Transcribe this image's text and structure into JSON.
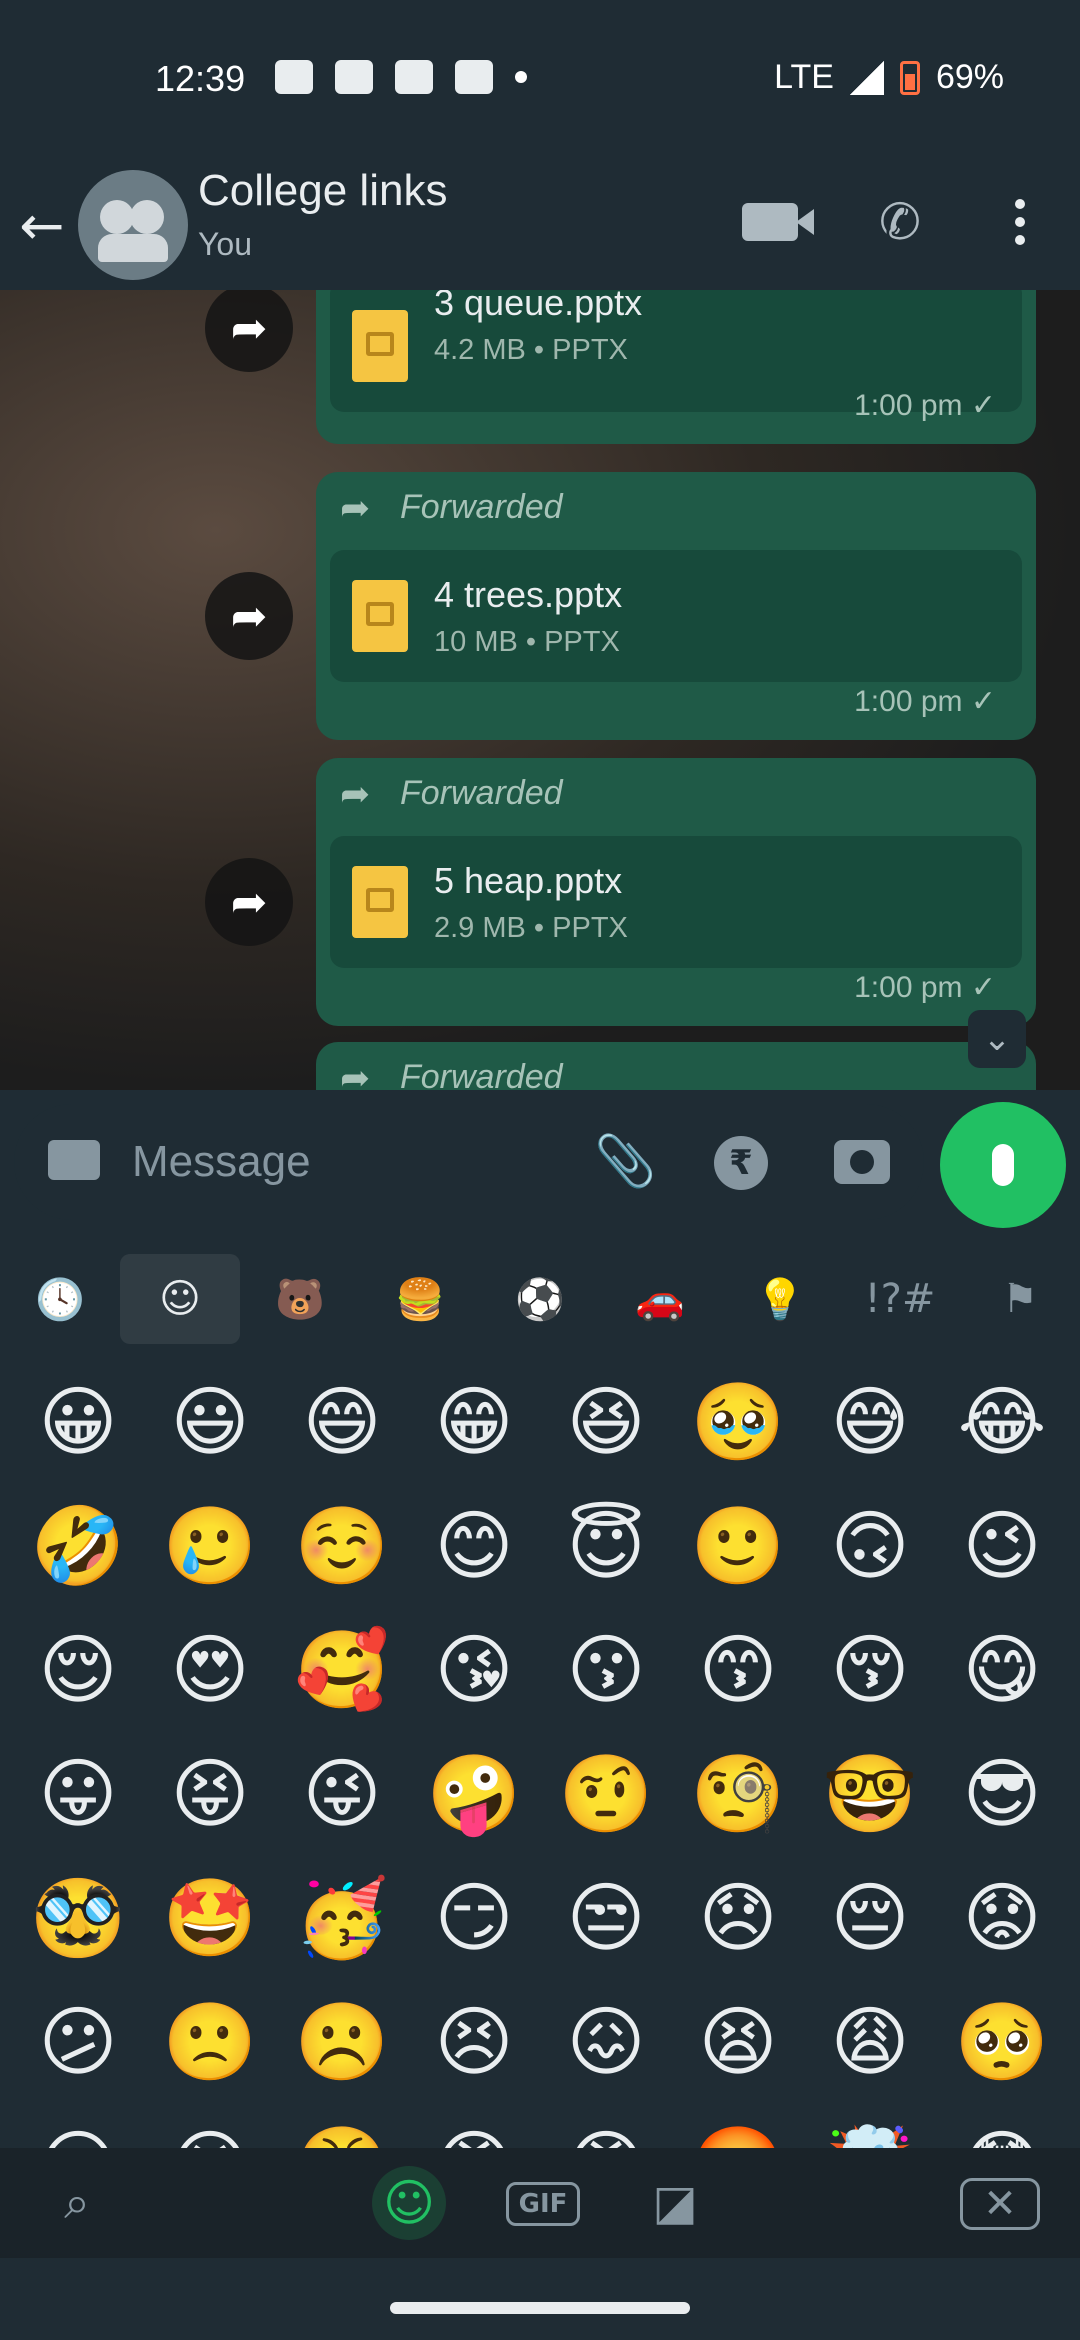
{
  "status_bar": {
    "time": "12:39",
    "network": "LTE",
    "battery": "69%"
  },
  "header": {
    "title": "College links",
    "subtitle": "You"
  },
  "messages": [
    {
      "forwarded": "",
      "file_name": "3 queue.pptx",
      "file_meta": "4.2 MB • PPTX",
      "time": "1:00 pm ✓"
    },
    {
      "forwarded": "Forwarded",
      "file_name": "4 trees.pptx",
      "file_meta": "10 MB • PPTX",
      "time": "1:00 pm ✓"
    },
    {
      "forwarded": "Forwarded",
      "file_name": "5 heap.pptx",
      "file_meta": "2.9 MB • PPTX",
      "time": "1:00 pm ✓"
    },
    {
      "forwarded": "Forwarded"
    }
  ],
  "composer": {
    "placeholder": "Message",
    "rupee": "₹"
  },
  "emoji_categories": [
    "recent",
    "smileys",
    "animals",
    "food",
    "activity",
    "travel",
    "objects",
    "symbols",
    "flags"
  ],
  "emoji_category_glyphs": [
    "🕓",
    "☺",
    "🐻",
    "🍔",
    "⚽",
    "🚗",
    "💡",
    "!?#",
    "⚑"
  ],
  "emojis": [
    "😀",
    "😃",
    "😄",
    "😁",
    "😆",
    "🥹",
    "😅",
    "😂",
    "🤣",
    "🥲",
    "☺️",
    "😊",
    "😇",
    "🙂",
    "🙃",
    "😉",
    "😌",
    "😍",
    "🥰",
    "😘",
    "😗",
    "😙",
    "😚",
    "😋",
    "😛",
    "😝",
    "😜",
    "🤪",
    "🤨",
    "🧐",
    "🤓",
    "😎",
    "🥸",
    "🤩",
    "🥳",
    "😏",
    "😒",
    "😞",
    "😔",
    "😟",
    "😕",
    "🙁",
    "☹️",
    "😣",
    "😖",
    "😫",
    "😩",
    "🥺",
    "😢",
    "😭",
    "😤",
    "😠",
    "😡",
    "🤬",
    "🤯",
    "😳"
  ],
  "bottom_bar": {
    "gif": "GIF"
  }
}
